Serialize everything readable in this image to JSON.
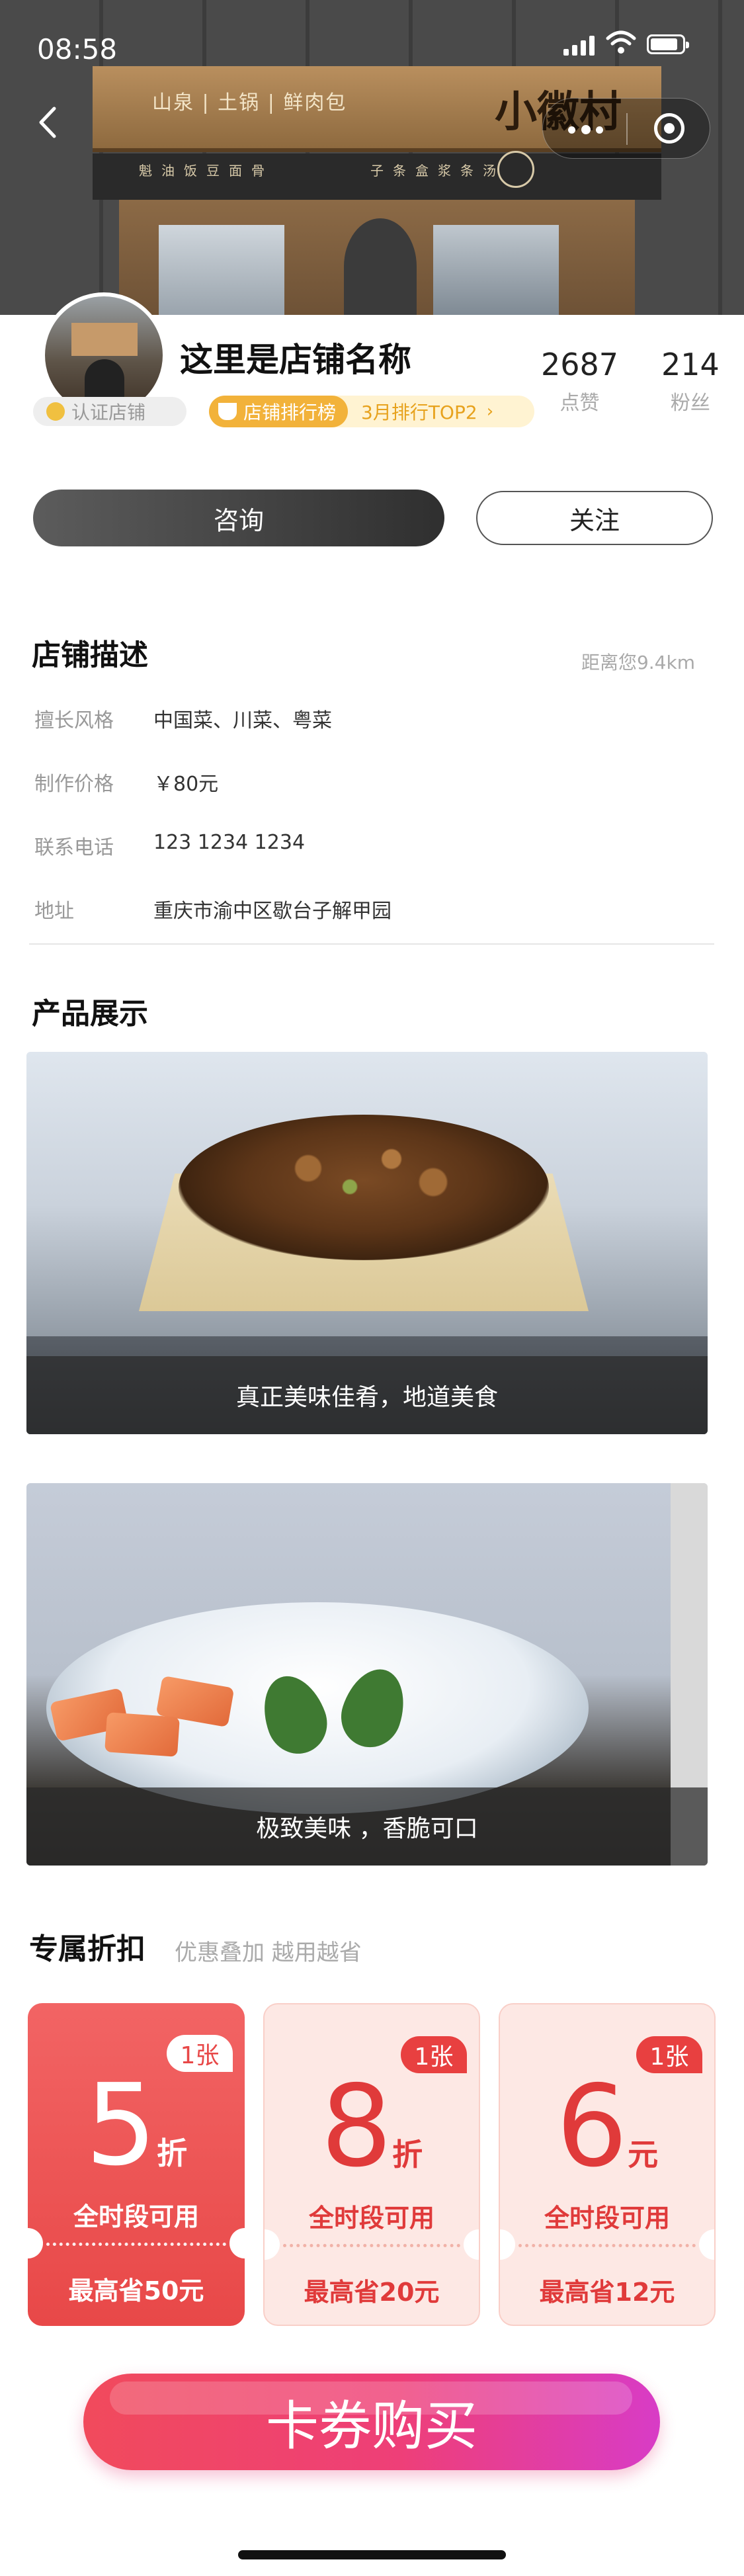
{
  "status_bar": {
    "time": "08:58"
  },
  "hero": {
    "sign_small": "山泉 | 土锅 | 鲜肉包",
    "sign_big": "小徽村",
    "band_left": "魁油饭豆面骨",
    "band_right": "子条盒浆条汤"
  },
  "shop": {
    "name": "这里是店铺名称",
    "certified_label": "认证店铺",
    "rank_label": "店铺排行榜",
    "rank_value": "3月排行TOP2",
    "likes": "2687",
    "likes_label": "点赞",
    "fans": "214",
    "fans_label": "粉丝"
  },
  "actions": {
    "consult": "咨询",
    "follow": "关注"
  },
  "description": {
    "title": "店铺描述",
    "distance": "距离您9.4km",
    "rows": [
      {
        "label": "擅长风格",
        "value": "中国菜、川菜、粤菜"
      },
      {
        "label": "制作价格",
        "value": "￥80元"
      },
      {
        "label": "联系电话",
        "value": "123 1234 1234"
      },
      {
        "label": "地址",
        "value": "重庆市渝中区歇台子解甲园"
      }
    ]
  },
  "products": {
    "title": "产品展示",
    "items": [
      {
        "caption": "真正美味佳肴，地道美食"
      },
      {
        "caption": "极致美味 ，香脆可口"
      }
    ]
  },
  "coupons": {
    "title": "专属折扣",
    "subtitle": "优惠叠加 越用越省",
    "items": [
      {
        "count": "1张",
        "amount": "5",
        "unit": "折",
        "availability": "全时段可用",
        "save": "最高省50元"
      },
      {
        "count": "1张",
        "amount": "8",
        "unit": "折",
        "availability": "全时段可用",
        "save": "最高省20元"
      },
      {
        "count": "1张",
        "amount": "6",
        "unit": "元",
        "availability": "全时段可用",
        "save": "最高省12元"
      }
    ]
  },
  "buy_button": "卡券购买",
  "colors": {
    "accent": "#e84848",
    "gold": "#f2b23a",
    "buy_gradient_start": "#f14a5c",
    "buy_gradient_end": "#d83cc6"
  }
}
